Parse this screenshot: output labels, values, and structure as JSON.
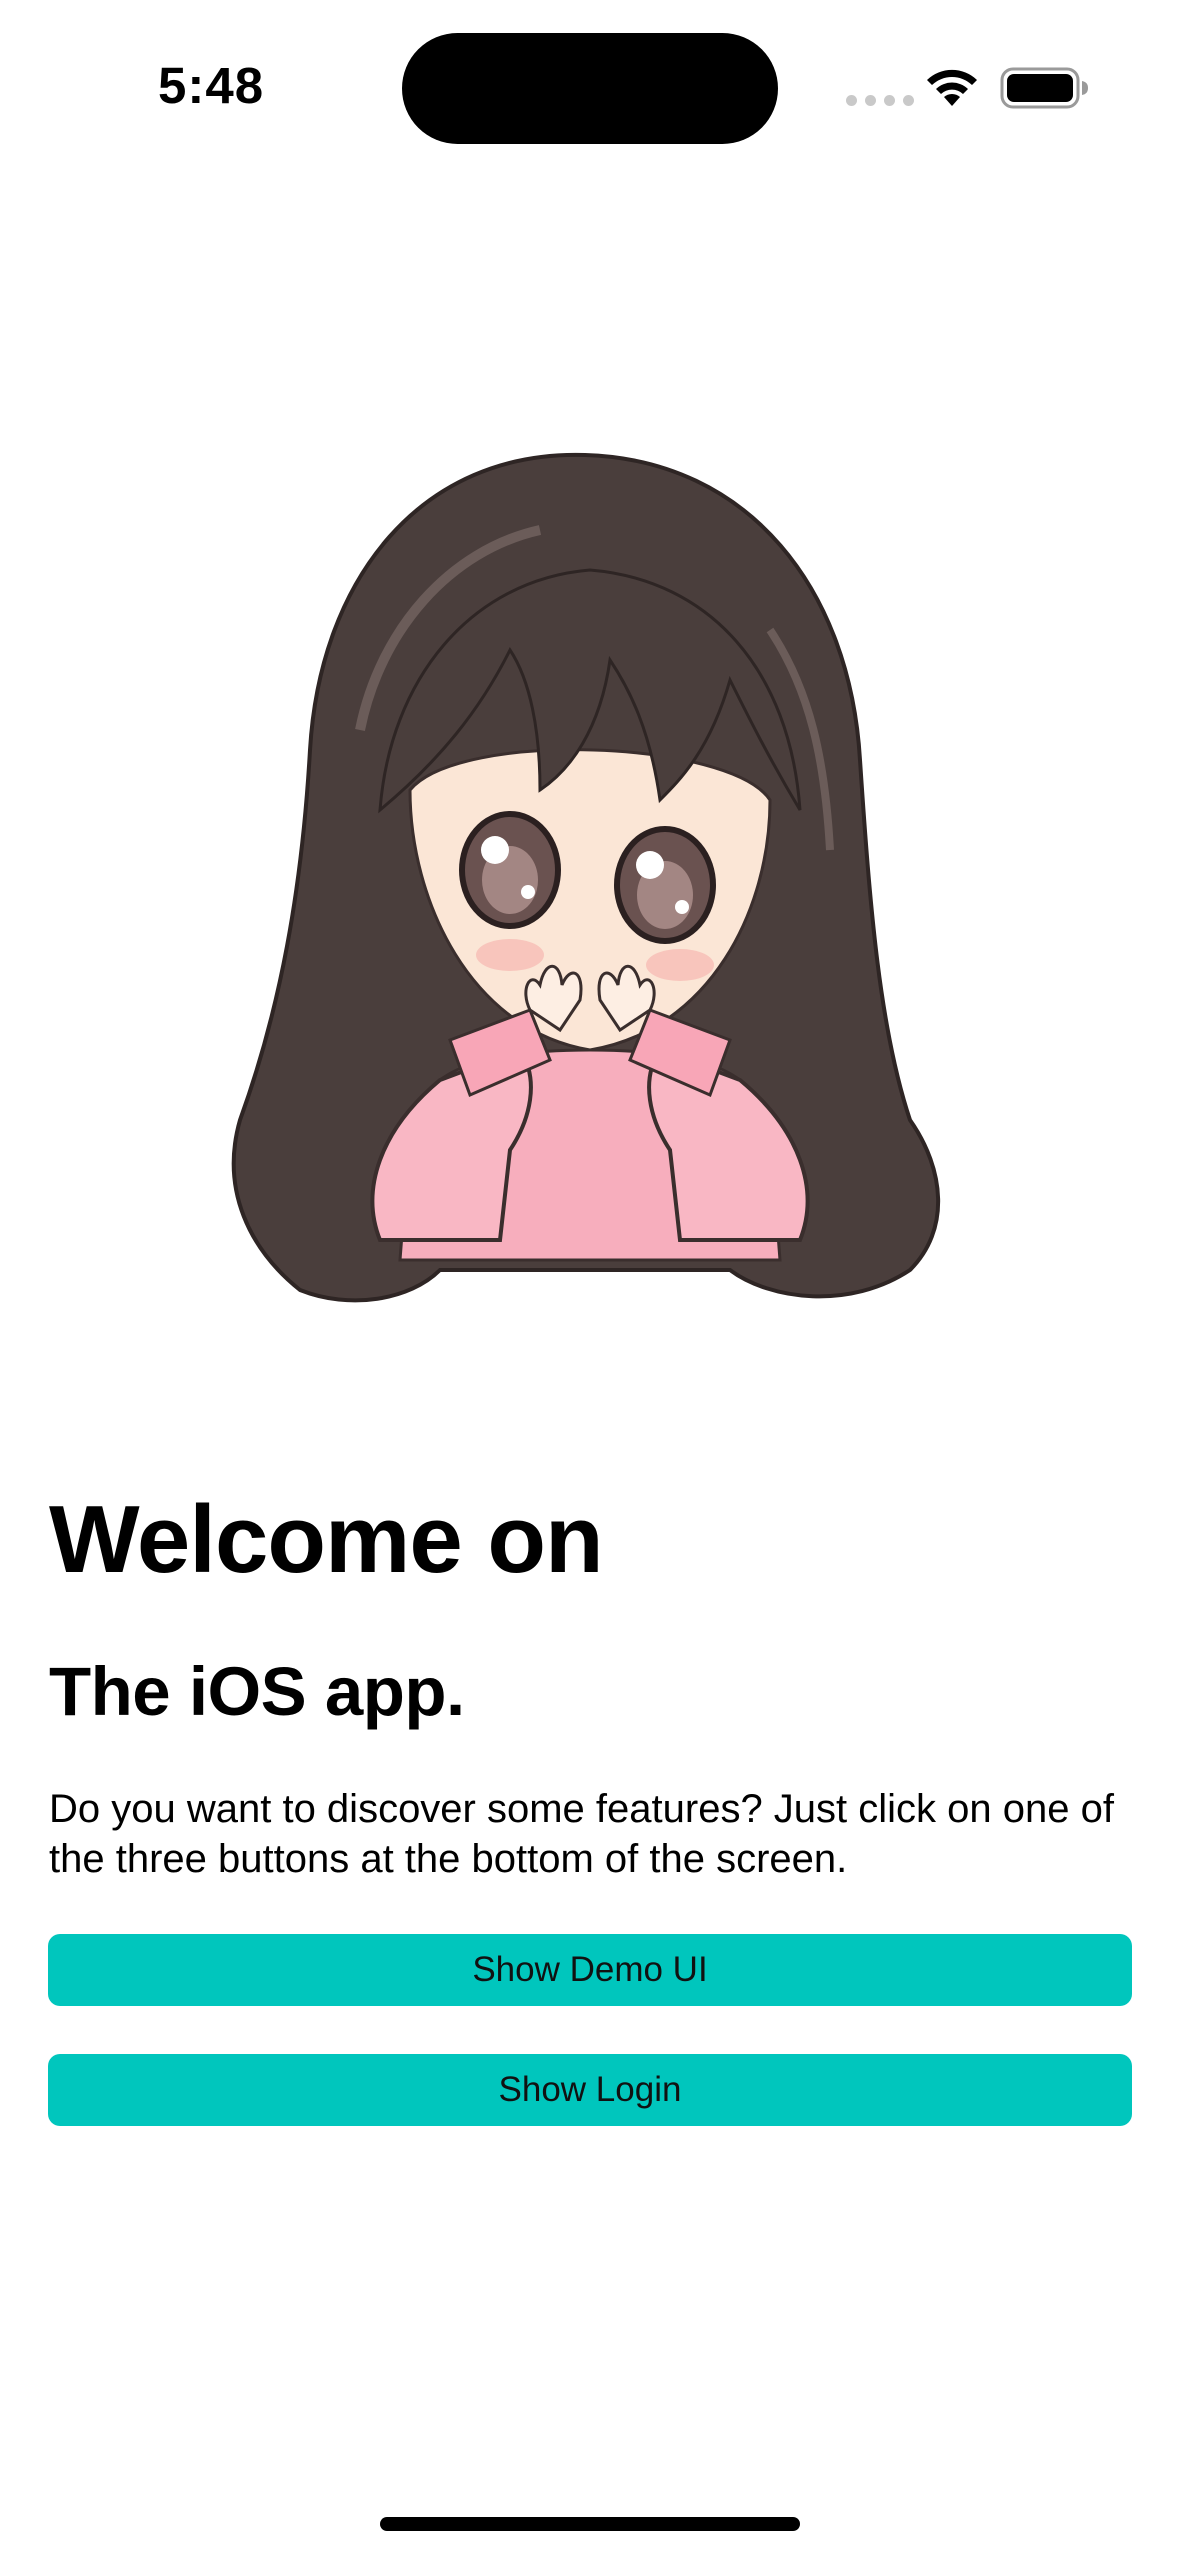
{
  "status_bar": {
    "time": "5:48",
    "icons": [
      "cellular-signal-icon",
      "wifi-icon",
      "battery-icon"
    ]
  },
  "hero": {
    "image": "anime-girl-illustration",
    "colors": {
      "hair": "#4a3e3c",
      "sweater": "#f7aebd",
      "skin": "#fbe6d6"
    }
  },
  "content": {
    "title": "Welcome on",
    "subtitle": "The iOS app.",
    "description": "Do you want to discover some features? Just click on one of the three buttons at the bottom of the screen."
  },
  "buttons": {
    "demo_label": "Show Demo UI",
    "login_label": "Show Login",
    "accent": "#00c6bd"
  }
}
